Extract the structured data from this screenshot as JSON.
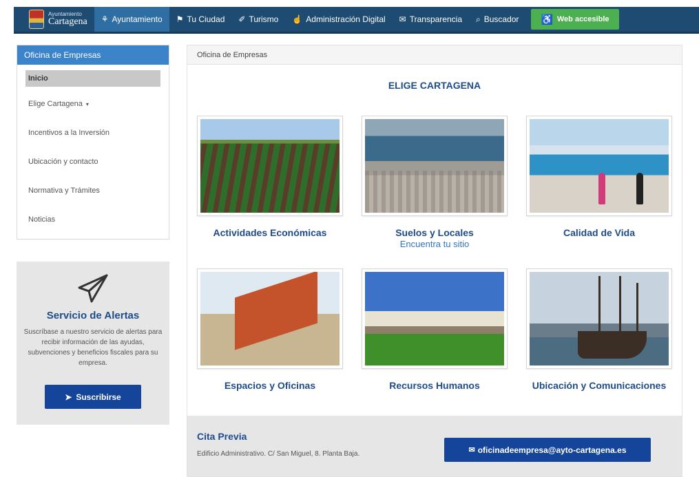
{
  "header": {
    "logo_small": "Ayuntamiento",
    "logo_big": "Cartagena",
    "nav": [
      {
        "icon": "⚘",
        "label": "Ayuntamiento",
        "active": true
      },
      {
        "icon": "⚑",
        "label": "Tu Ciudad"
      },
      {
        "icon": "✐",
        "label": "Turismo"
      },
      {
        "icon": "☝",
        "label": "Administración Digital"
      },
      {
        "icon": "✉",
        "label": "Transparencia"
      },
      {
        "icon": "⌕",
        "label": "Buscador"
      }
    ],
    "accessible_icon": "♿",
    "accessible_label": "Web accesible"
  },
  "sidebar": {
    "heading": "Oficina de Empresas",
    "items": [
      {
        "label": "Inicio"
      },
      {
        "label": "Elige Cartagena",
        "caret": "▾"
      },
      {
        "label": "Incentivos a la Inversión"
      },
      {
        "label": "Ubicación y contacto"
      },
      {
        "label": "Normativa y Trámites"
      },
      {
        "label": "Noticias"
      }
    ]
  },
  "alerts": {
    "title": "Servicio de Alertas",
    "text": "Suscríbase a nuestro servicio de alertas para recibir información de las ayudas, subvenciones y beneficios fiscales para su empresa.",
    "button_icon": "➤",
    "button_label": "Suscribirse"
  },
  "main": {
    "breadcrumb": "Oficina de Empresas",
    "title": "ELIGE CARTAGENA",
    "cards": [
      {
        "title": "Actividades Económicas"
      },
      {
        "title": "Suelos y Locales",
        "subtitle": "Encuentra tu sitio"
      },
      {
        "title": "Calidad de Vida"
      },
      {
        "title": "Espacios y Oficinas"
      },
      {
        "title": "Recursos Humanos"
      },
      {
        "title": "Ubicación y Comunicaciones"
      }
    ]
  },
  "footer": {
    "title": "Cita Previa",
    "address": "Edificio Administrativo. C/ San Miguel, 8. Planta Baja.",
    "email_icon": "✉",
    "email": "oficinadeempresa@ayto-cartagena.es"
  },
  "colors": {
    "topbar": "#1e4b72",
    "active_nav": "#2f6ea3",
    "accessible": "#4caf50",
    "primary_text": "#1e4b8a",
    "button": "#14459a",
    "sidebar_head": "#3c84c9"
  }
}
